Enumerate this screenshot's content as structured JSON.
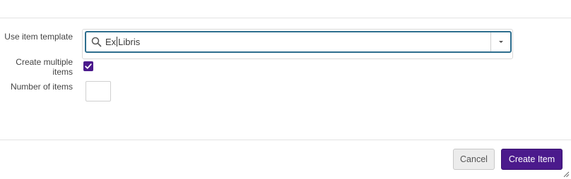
{
  "form": {
    "use_item_template_label": "Use item template",
    "template_value_before_cursor": "Ex",
    "template_value_after_cursor": "Libris",
    "create_multiple_label": "Create multiple items",
    "create_multiple_checked": true,
    "number_of_items_label": "Number of items",
    "number_of_items_value": ""
  },
  "footer": {
    "cancel_label": "Cancel",
    "create_label": "Create Item"
  },
  "icons": {
    "search": "search-icon",
    "dropdown": "chevron-down-icon",
    "checkmark": "checkmark-icon",
    "resize": "resize-grip-icon"
  },
  "colors": {
    "accent": "#4b1a8c",
    "focus_border": "#2d6e8e"
  }
}
